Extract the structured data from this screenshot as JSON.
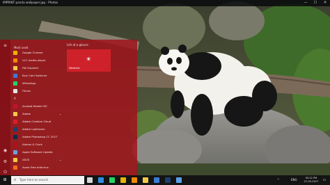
{
  "window": {
    "title": "IMPRINT panda wallpaper.jpg - Photos",
    "controls": {
      "minimize": "—",
      "maximize": "☐",
      "close": "✕"
    }
  },
  "start_menu": {
    "rail_icons": [
      "hamburger-icon",
      "user-icon",
      "gear-icon",
      "power-icon"
    ],
    "rail_glyphs": {
      "menu": "≡",
      "user": "◉",
      "settings": "⚙",
      "power": "⏻"
    },
    "most_used_label": "Most used",
    "most_used": [
      {
        "label": "Google Chrome",
        "icon": "chrome-icon",
        "color": "#e8b400"
      },
      {
        "label": "VLC media player",
        "icon": "vlc-icon",
        "color": "#f08a00"
      },
      {
        "label": "File Explorer",
        "icon": "folder-icon",
        "color": "#f2c94c"
      },
      {
        "label": "Epic Cam Switcher",
        "icon": "camera-icon",
        "color": "#3a7bd5"
      },
      {
        "label": "WhatsApp",
        "icon": "whatsapp-icon",
        "color": "#25d366"
      },
      {
        "label": "iTunes",
        "icon": "itunes-icon",
        "color": "#e6e6e6"
      }
    ],
    "section_letter": "A",
    "all_apps": [
      {
        "label": "Acrobat Reader DC",
        "icon": "acrobat-icon",
        "color": "#c8102e"
      },
      {
        "label": "Adobe",
        "icon": "folder-icon",
        "color": "#f2c94c",
        "expand": "⌄"
      },
      {
        "label": "Adobe Creative Cloud",
        "icon": "creative-cloud-icon",
        "color": "#da1f26"
      },
      {
        "label": "Adobe Lightroom",
        "icon": "lightroom-icon",
        "color": "#1c3f6e"
      },
      {
        "label": "Adobe Photoshop CC 2017",
        "icon": "photoshop-icon",
        "color": "#0a2d4d"
      },
      {
        "label": "Alarms & Clock",
        "icon": "clock-icon",
        "color": "#b0101c"
      },
      {
        "label": "Apple Software Update",
        "icon": "apple-update-icon",
        "color": "#6aa0e0"
      },
      {
        "label": "ASUS",
        "icon": "folder-icon",
        "color": "#f2c94c",
        "expand": "⌄"
      },
      {
        "label": "Avast Free Antivirus",
        "icon": "avast-icon",
        "color": "#f26b1d"
      }
    ],
    "tiles_header": "Life at a glance",
    "weather_tile": {
      "label": "Weather",
      "glyph": "☀"
    }
  },
  "taskbar": {
    "start_glyph": "⊞",
    "search_glyph": "⌕",
    "search_placeholder": "Type here to search",
    "pinned": [
      {
        "name": "task-view-icon",
        "color": "#d8d8d8"
      },
      {
        "name": "edge-icon",
        "color": "#2f8ee0"
      },
      {
        "name": "whatsapp-icon",
        "color": "#25d366"
      },
      {
        "name": "chrome-icon",
        "color": "#e8b400"
      },
      {
        "name": "vlc-icon",
        "color": "#f08a00"
      },
      {
        "name": "file-explorer-icon",
        "color": "#f2c94c"
      },
      {
        "name": "store-icon",
        "color": "#3a7bd5"
      },
      {
        "name": "lightroom-icon",
        "color": "#1c3f6e"
      },
      {
        "name": "photos-icon",
        "color": "#5aa0e6"
      }
    ],
    "tray": {
      "chevron": "^",
      "language": "ENG",
      "time": "05:22 PM",
      "date": "27-05-2017",
      "notification_glyph": "▭"
    }
  }
}
